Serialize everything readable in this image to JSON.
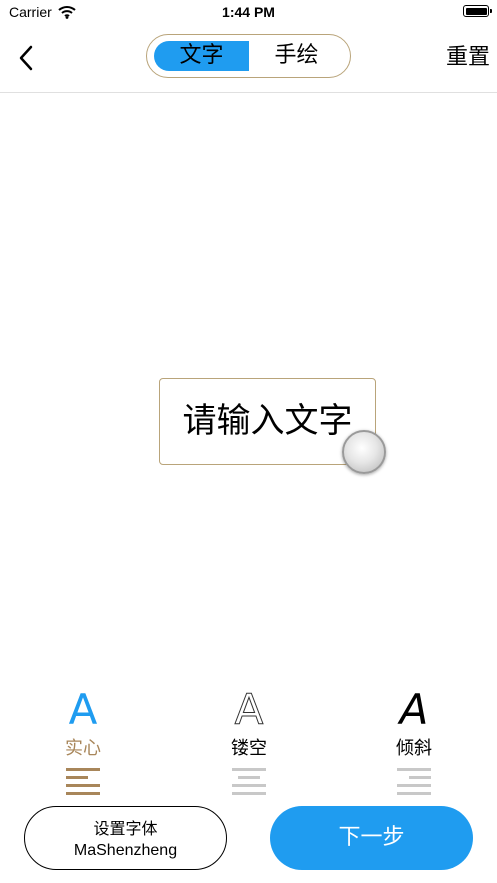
{
  "status_bar": {
    "carrier": "Carrier",
    "time": "1:44 PM"
  },
  "nav": {
    "back_icon": "chevron-left-icon",
    "segments": [
      "文字",
      "手绘"
    ],
    "selected_segment": "文字",
    "reset_label": "重置"
  },
  "canvas": {
    "placeholder_text": "请输入文字"
  },
  "styles": [
    {
      "glyph": "A",
      "label": "实心",
      "selected": true
    },
    {
      "glyph": "A",
      "label": "镂空",
      "selected": false
    },
    {
      "glyph": "A",
      "label": "倾斜",
      "selected": false
    }
  ],
  "footer": {
    "font_button_title": "设置字体",
    "font_name": "MaShenzheng",
    "next_label": "下一步"
  },
  "colors": {
    "accent": "#1f9cf0",
    "gold": "#b9a47a",
    "gold_text": "#a8865a",
    "muted": "#c8c8c8"
  }
}
